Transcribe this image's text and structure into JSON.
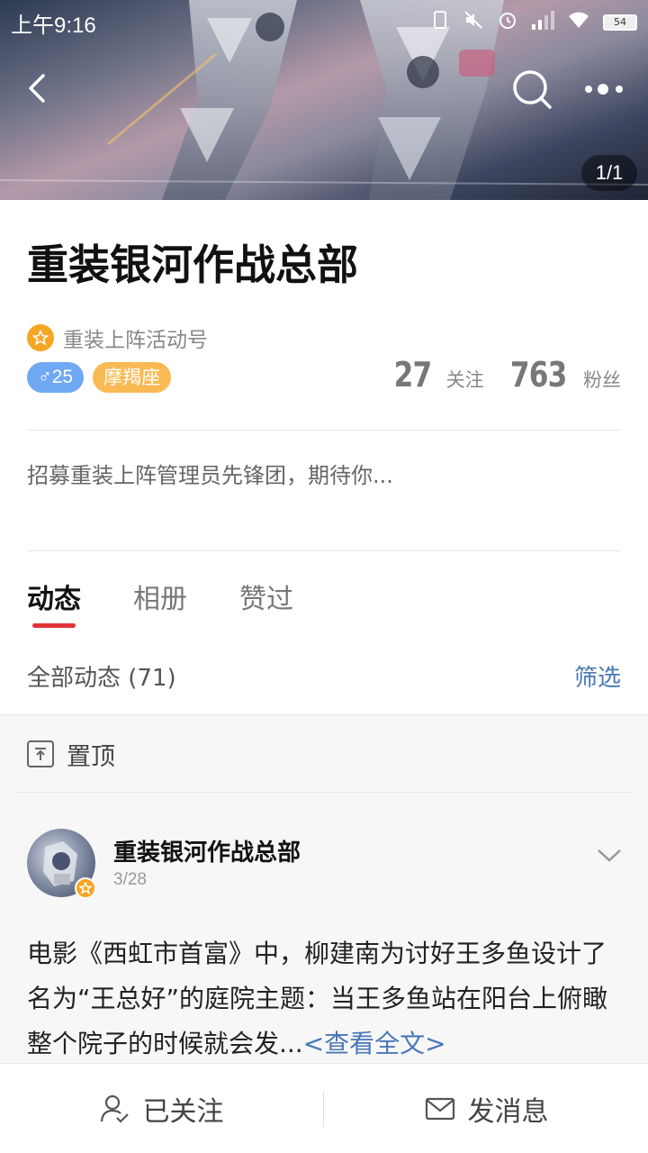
{
  "status_bar": {
    "time": "上午9:16",
    "battery": "54"
  },
  "header": {
    "page_indicator": "1/1"
  },
  "profile": {
    "name": "重装银河作战总部",
    "verified_label": "重装上阵活动号",
    "gender_age": "♂25",
    "zodiac": "摩羯座",
    "following_count": "27",
    "following_label": "关注",
    "followers_count": "763",
    "followers_label": "粉丝",
    "bio": "招募重装上阵管理员先锋团，期待你..."
  },
  "tabs": [
    {
      "label": "动态",
      "active": true
    },
    {
      "label": "相册",
      "active": false
    },
    {
      "label": "赞过",
      "active": false
    }
  ],
  "feed": {
    "count_label": "全部动态 (71)",
    "filter_label": "筛选",
    "pinned_label": "置顶",
    "post": {
      "author": "重装银河作战总部",
      "date": "3/28",
      "text": "电影《西虹市首富》中，柳建南为讨好王多鱼设计了名为“王总好”的庭院主题：当王多鱼站在阳台上俯瞰整个院子的时候就会发...",
      "read_more": "<查看全文>"
    }
  },
  "bottom_bar": {
    "followed_label": "已关注",
    "message_label": "发消息"
  },
  "colors": {
    "accent_red": "#e3333b",
    "link_blue": "#4a78b5",
    "badge_orange": "#f5a623",
    "gender_blue": "#6fa8f3",
    "zodiac_orange": "#f9b953"
  },
  "icons": [
    "back-arrow-icon",
    "search-icon",
    "more-dots-icon",
    "star-icon",
    "pin-top-icon",
    "chevron-down-icon",
    "user-check-icon",
    "mail-icon"
  ]
}
